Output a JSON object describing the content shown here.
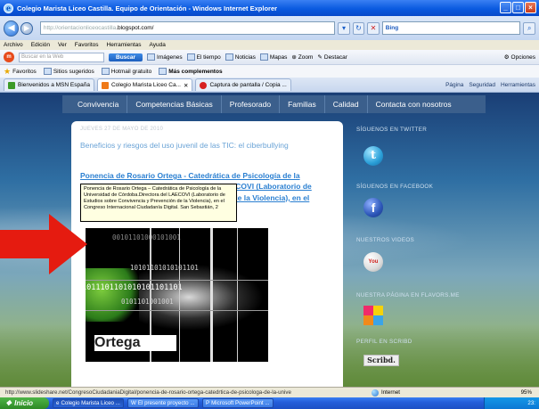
{
  "window": {
    "title": "Colegio Marista Liceo Castilla. Equipo de Orientación - Windows Internet Explorer",
    "buttons": {
      "min": "_",
      "max": "□",
      "close": "×"
    }
  },
  "address_bar": {
    "url_prefix": "http://",
    "url_mid": "orientacionliceocastilla",
    "url_host": ".blogspot.com/",
    "search_engine": "Bing"
  },
  "menu": [
    "Archivo",
    "Edición",
    "Ver",
    "Favoritos",
    "Herramientas",
    "Ayuda"
  ],
  "msn_toolbar": {
    "search_placeholder": "Buscar en la Web",
    "search_button": "Buscar",
    "items": [
      "Imágenes",
      "El tiempo",
      "Noticias",
      "Mapas",
      "Zoom",
      "Destacar"
    ],
    "options": "Opciones"
  },
  "favorites_bar": {
    "label": "Favoritos",
    "items": [
      "Sitios sugeridos",
      "Hotmail gratuito",
      "Más complementos"
    ]
  },
  "tabs": [
    {
      "label": "Bienvenidos a MSN España"
    },
    {
      "label": "Colegio Marista Liceo Ca..."
    },
    {
      "label": "Captura de pantalla / Copia ..."
    }
  ],
  "tab_tools": [
    "Página",
    "Seguridad",
    "Herramientas"
  ],
  "blog_nav": [
    "Convivencia",
    "Competencias Básicas",
    "Profesorado",
    "Familias",
    "Calidad",
    "Contacta con nosotros"
  ],
  "post": {
    "date": "JUEVES 27 DE MAYO DE 2010",
    "title": "Beneficios y riesgos del uso juvenil de las TIC: el ciberbullying",
    "link_text": "Ponencia de Rosario Ortega - Catedrática de Psicología de la Universidad de Córdoba. Directora del LAECOVI (Laboratorio de Estudios sobre Convivencia y Prevención de la Violencia), en el Congreso Internacional Ciudadanía",
    "tooltip": "Ponencia de Rosario Ortega – Catedrática de Psicología de la Universidad de Córdoba.Directora del LAECOVI (Laboratorio de Estudios sobre Convivencia y Prevención de la Violencia), en el Congreso Internacional Ciudadanía Digital. San Sebastián, 2",
    "slide_name": "Ortega",
    "binary_rows": [
      "00101101000101001",
      "10101101010101101",
      "1011101101010101101101",
      "0101101001001"
    ]
  },
  "sidebar": {
    "twitter_heading": "SÍGUENOS EN TWITTER",
    "facebook_heading": "SÍGUENOS EN FACEBOOK",
    "videos_heading": "NUESTROS VIDEOS",
    "flavors_heading": "NUESTRA PÁGINA EN FLAVORS.ME",
    "scribd_heading": "PERFIL EN SCRIBD",
    "twitter_glyph": "t",
    "facebook_glyph": "f",
    "youtube_glyph": "You",
    "scribd_label": "Scribd."
  },
  "status_bar": {
    "url": "http://www.slideshare.net/CongresoCiudadaniaDigital/ponencia-de-rosario-ortega-catedrtica-de-psicologa-de-la-unive",
    "zone": "Internet",
    "zoom": "95%"
  },
  "taskbar": {
    "start": "Inicio",
    "tasks": [
      "Colegio Marista Liceo ...",
      "El presente proyecto ...",
      "Microsoft PowerPoint ..."
    ],
    "clock": "23:"
  },
  "colors": {
    "nav_bg": "#3b5f8c",
    "link": "#2a7fd1",
    "title": "#6aa3d6",
    "arrow": "#e51b10"
  }
}
